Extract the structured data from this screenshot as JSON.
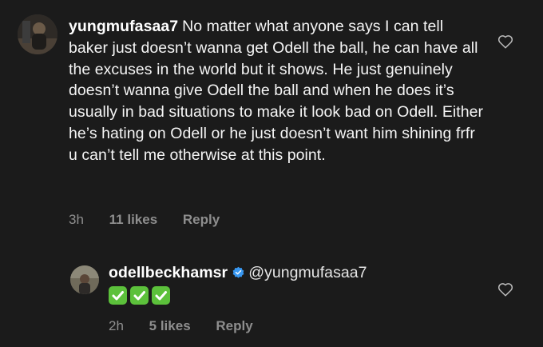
{
  "comments": [
    {
      "username": "yungmufasaa7",
      "text": "No matter what anyone says I can tell baker just doesn’t wanna get Odell the ball, he can have all the excuses in the world but it shows. He just genuinely doesn’t wanna give Odell the ball and when he does it’s usually in bad situations to make it look bad on Odell. Either he’s hating on Odell or he just doesn’t want him shining frfr u can’t tell me otherwise at this point.",
      "time": "3h",
      "likes": "11 likes",
      "reply_label": "Reply"
    }
  ],
  "reply": {
    "username": "odellbeckhamsr",
    "mention": "@yungmufasaa7",
    "checkmarks": [
      "check-mark-button",
      "check-mark-button",
      "check-mark-button"
    ],
    "time": "2h",
    "likes": "5 likes",
    "reply_label": "Reply"
  },
  "icons": {
    "like": "heart-outline-icon",
    "verified": "verified-badge-icon"
  },
  "colors": {
    "background": "#1b1b1b",
    "text": "#f5f5f5",
    "meta": "#8e8e8e",
    "verified": "#3897f0",
    "checkbox": "#5cc13b"
  }
}
